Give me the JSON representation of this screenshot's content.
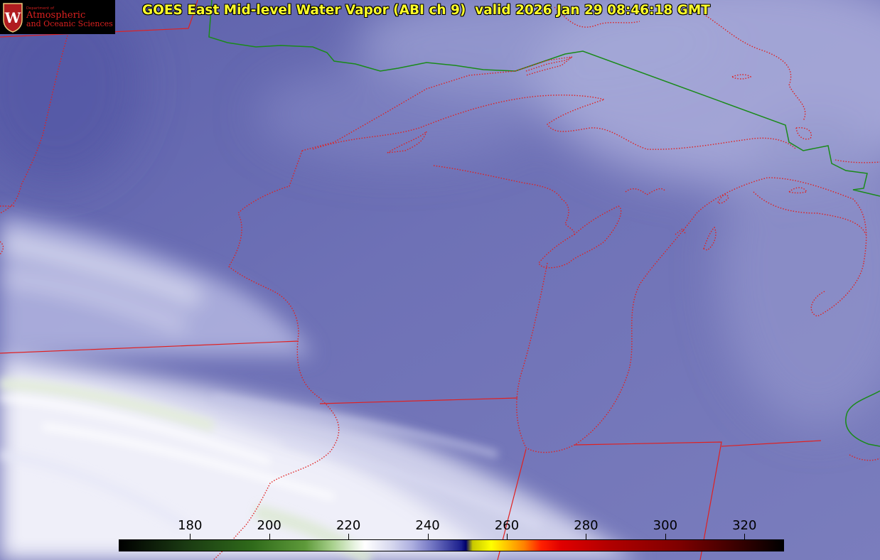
{
  "title": "GOES East Mid-level Water Vapor (ABI ch 9)  valid 2026 Jan 29 08:46:18 GMT",
  "logo": {
    "line1": "Department of",
    "line2": "Atmospheric",
    "line3": "and Oceanic Sciences",
    "mark": "W"
  },
  "colorbar": {
    "ticks": [
      "180",
      "200",
      "220",
      "240",
      "260",
      "280",
      "300",
      "320"
    ],
    "tick_values": [
      180,
      200,
      220,
      240,
      260,
      280,
      300,
      320
    ],
    "range": [
      162,
      330
    ]
  },
  "colors": {
    "title": "#ffff2a",
    "state_borders": "#e02020",
    "country_border": "#1a8a1a",
    "logo_text": "#d9201f",
    "background_vapor": "#6f72b4"
  }
}
